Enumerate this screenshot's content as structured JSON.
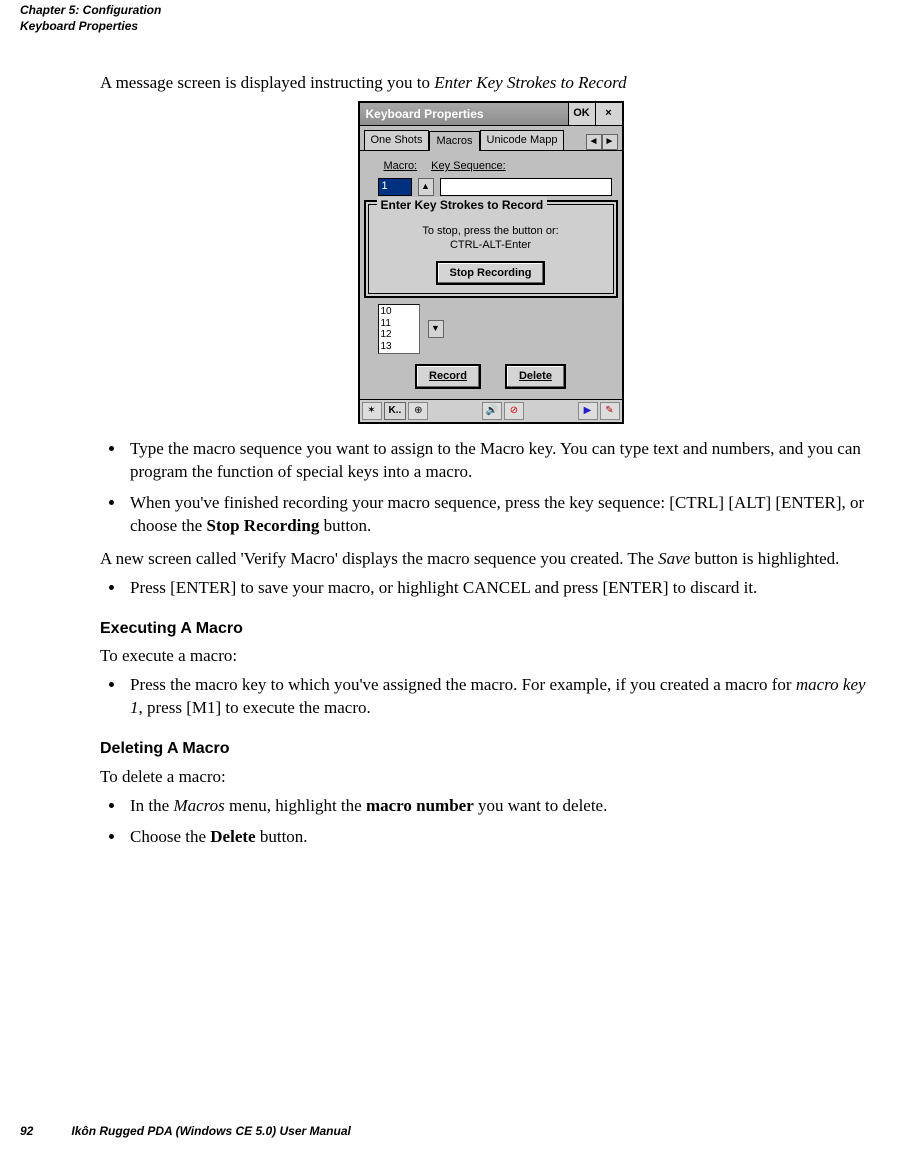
{
  "header": {
    "line1": "Chapter 5:  Configuration",
    "line2": "Keyboard Properties"
  },
  "intro": {
    "text_a": "A message screen is displayed instructing you to ",
    "text_b": "Enter Key Strokes to Record"
  },
  "shot": {
    "title": "Keyboard Properties",
    "ok": "OK",
    "close": "×",
    "tab1": "One Shots",
    "tab2": "Macros",
    "tab3": "Unicode Mapp",
    "arrow_l": "◄",
    "arrow_r": "►",
    "lbl_macro": "Macro:",
    "lbl_seq": "Key Sequence:",
    "macro_value": "1",
    "spin": "▲",
    "dialog_legend": "Enter Key Strokes to Record",
    "dialog_line1": "To stop, press the button or:",
    "dialog_line2": "CTRL-ALT-Enter",
    "stop_btn": "Stop Recording",
    "list_items": [
      "10",
      "11",
      "12",
      "13"
    ],
    "list_spin": "▼",
    "btn_record": "Record",
    "btn_delete": "Delete",
    "task_kb": "K..",
    "task_start": "✶",
    "task_net": "⊕",
    "task_vol": "🔊",
    "task_play": "▶",
    "task_pen": "✎"
  },
  "bullets1": {
    "a": "Type the macro sequence you want to assign to the Macro key. You can type text and numbers, and you can program the function of special keys into a macro.",
    "b_pre": "When you've finished recording your macro sequence, press the key sequence: [CTRL] [ALT] [ENTER], or choose the ",
    "b_strong": "Stop Recording",
    "b_post": " button."
  },
  "para2": {
    "pre": "A new screen called 'Verify Macro' displays the macro sequence you created. The ",
    "em": "Save",
    "post": " button is highlighted."
  },
  "bullets2": {
    "a": "Press [ENTER] to save your macro, or highlight CANCEL and press [ENTER] to discard it."
  },
  "sec_exec": "Executing A Macro",
  "exec_intro": "To execute a macro:",
  "bullets3": {
    "a_pre": "Press the macro key to which you've assigned the macro. For example, if you created a macro for ",
    "a_em": "macro key 1",
    "a_post": ", press [M1] to execute the macro."
  },
  "sec_del": "Deleting A Macro",
  "del_intro": "To delete a macro:",
  "bullets4": {
    "a_pre": "In the ",
    "a_em": "Macros",
    "a_mid": " menu, highlight the ",
    "a_strong": "macro number",
    "a_post": " you want to delete.",
    "b_pre": "Choose the ",
    "b_strong": "Delete",
    "b_post": " button."
  },
  "footer": {
    "page": "92",
    "title": "Ikôn Rugged PDA (Windows CE 5.0) User Manual"
  }
}
